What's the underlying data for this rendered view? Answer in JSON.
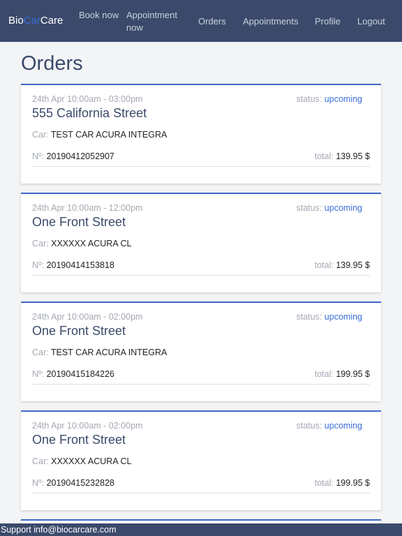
{
  "brand": {
    "part1": "Bio",
    "part2": "Car",
    "part3": "Care"
  },
  "nav": {
    "book_now": "Book now",
    "appointment_now": "Appointment now",
    "orders": "Orders",
    "appointments": "Appointments",
    "profile": "Profile",
    "logout": "Logout"
  },
  "page": {
    "title": "Orders"
  },
  "labels": {
    "status": "status:",
    "car": "Car:",
    "number": "Nº:",
    "total": "total:"
  },
  "orders": [
    {
      "date": "24th Apr 10:00am - 03:00pm",
      "status": "upcoming",
      "address": "555 California Street",
      "car": "TEST CAR ACURA INTEGRA",
      "number": "20190412052907",
      "total": "139.95 $"
    },
    {
      "date": "24th Apr 10:00am - 12:00pm",
      "status": "upcoming",
      "address": "One Front Street",
      "car": "XXXXXX ACURA CL",
      "number": "20190414153818",
      "total": "139.95 $"
    },
    {
      "date": "24th Apr 10:00am - 02:00pm",
      "status": "upcoming",
      "address": "One Front Street",
      "car": "TEST CAR ACURA INTEGRA",
      "number": "20190415184226",
      "total": "199.95 $"
    },
    {
      "date": "24th Apr 10:00am - 02:00pm",
      "status": "upcoming",
      "address": "One Front Street",
      "car": "XXXXXX ACURA CL",
      "number": "20190415232828",
      "total": "199.95 $"
    }
  ],
  "footer": {
    "text": "Support info@biocarcare.com"
  },
  "colors": {
    "navbar": "#3b4a6b",
    "accent": "#3a6fd8",
    "card_border": "#3f6ac9"
  }
}
